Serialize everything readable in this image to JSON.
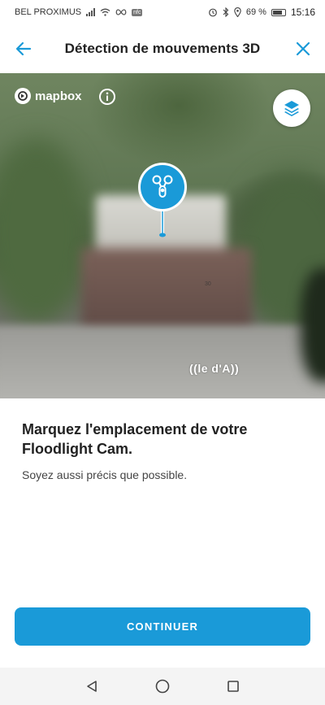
{
  "status_bar": {
    "carrier": "BEL PROXIMUS",
    "nfc_badge": "nfc",
    "battery_percent": "69 %",
    "time": "15:16"
  },
  "header": {
    "title": "Détection de mouvements 3D",
    "back_icon": "arrow-left-icon",
    "close_icon": "close-icon"
  },
  "map": {
    "provider": "mapbox",
    "pin_label": "((le d'A))",
    "tiny_label": "30",
    "layers_icon": "layers-icon",
    "info_icon": "info-icon"
  },
  "content": {
    "heading": "Marquez l'emplacement de votre Floodlight Cam.",
    "subtext": "Soyez aussi précis que possible."
  },
  "actions": {
    "continue_label": "CONTINUER"
  },
  "colors": {
    "accent": "#1a9ad8",
    "accent_dark": "#1587c4"
  }
}
